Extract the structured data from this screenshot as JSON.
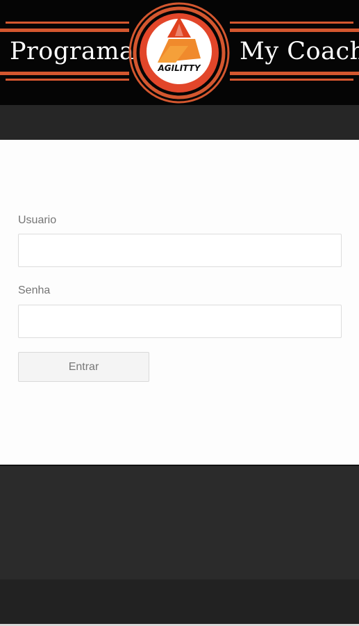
{
  "header": {
    "title_left": "Programa",
    "title_right": "My Coach",
    "logo_text": "AGILITTY",
    "logo_icon": "triangle-a-logo-icon",
    "accent_color": "#d4572f"
  },
  "login": {
    "username_label": "Usuario",
    "username_value": "",
    "password_label": "Senha",
    "password_value": "",
    "submit_label": "Entrar"
  },
  "colors": {
    "header_bg": "#050505",
    "band_bg": "#262626",
    "panel_bg": "#fdfdfd",
    "footer_bg": "#2b2b2b"
  }
}
